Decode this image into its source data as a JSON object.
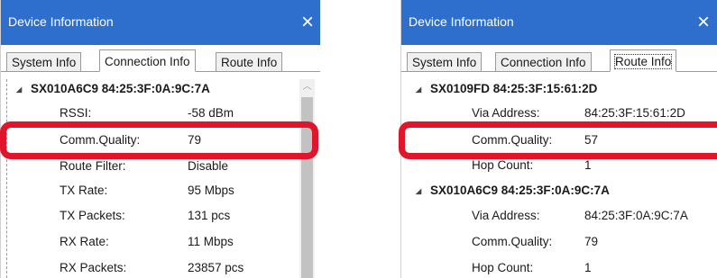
{
  "left_panel": {
    "title": "Device Information",
    "close_icon": "×",
    "tabs": [
      {
        "label": "System Info",
        "active": false
      },
      {
        "label": "Connection Info",
        "active": true
      },
      {
        "label": "Route Info",
        "active": false
      }
    ],
    "node": {
      "expander": "◢",
      "title": "SX010A6C9 84:25:3F:0A:9C:7A",
      "rows": [
        {
          "key": "RSSI:",
          "value": "-58 dBm"
        },
        {
          "key": "Comm.Quality:",
          "value": "79"
        },
        {
          "key": "Route Filter:",
          "value": "Disable"
        },
        {
          "key": "TX Rate:",
          "value": "95 Mbps"
        },
        {
          "key": "TX Packets:",
          "value": "131 pcs"
        },
        {
          "key": "RX Rate:",
          "value": "11 Mbps"
        },
        {
          "key": "RX Packets:",
          "value": "23857 pcs"
        }
      ]
    },
    "scroll_up_icon": "︿"
  },
  "right_panel": {
    "title": "Device Information",
    "close_icon": "×",
    "tabs": [
      {
        "label": "System Info",
        "active": false
      },
      {
        "label": "Connection Info",
        "active": false
      },
      {
        "label": "Route Info",
        "active": true
      }
    ],
    "nodes": [
      {
        "expander": "◢",
        "title": "SX0109FD 84:25:3F:15:61:2D",
        "rows": [
          {
            "key": "Via Address:",
            "value": "84:25:3F:15:61:2D"
          },
          {
            "key": "Comm.Quality:",
            "value": "57"
          },
          {
            "key": "Hop Count:",
            "value": "1"
          }
        ]
      },
      {
        "expander": "◢",
        "title": "SX010A6C9 84:25:3F:0A:9C:7A",
        "rows": [
          {
            "key": "Via Address:",
            "value": "84:25:3F:0A:9C:7A"
          },
          {
            "key": "Comm.Quality:",
            "value": "79"
          },
          {
            "key": "Hop Count:",
            "value": "1"
          }
        ]
      }
    ]
  },
  "colors": {
    "titlebar": "#2e6fce",
    "highlight": "#e0142a"
  }
}
